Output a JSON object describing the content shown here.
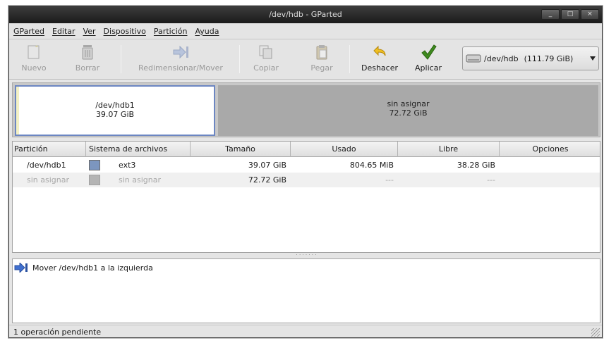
{
  "window": {
    "title": "/dev/hdb - GParted",
    "controls": {
      "minimize": "_",
      "maximize": "□",
      "close": "×"
    }
  },
  "menu": [
    "GParted",
    "Editar",
    "Ver",
    "Dispositivo",
    "Partición",
    "Ayuda"
  ],
  "toolbar": {
    "new": "Nuevo",
    "delete": "Borrar",
    "resize_move": "Redimensionar/Mover",
    "copy": "Copiar",
    "paste": "Pegar",
    "undo": "Deshacer",
    "apply": "Aplicar"
  },
  "device": {
    "name": "/dev/hdb",
    "size": "(111.79 GiB)"
  },
  "disk_map": [
    {
      "name": "/dev/hdb1",
      "size": "39.07 GiB"
    },
    {
      "name": "sin asignar",
      "size": "72.72 GiB"
    }
  ],
  "table": {
    "columns": [
      "Partición",
      "Sistema de archivos",
      "Tamaño",
      "Usado",
      "Libre",
      "Opciones"
    ],
    "rows": [
      {
        "partition": "/dev/hdb1",
        "filesystem": "ext3",
        "fs_color": "#7c96bf",
        "size": "39.07 GiB",
        "used": "804.65 MiB",
        "free": "38.28 GiB",
        "options": ""
      },
      {
        "partition": "sin asignar",
        "filesystem": "sin asignar",
        "fs_color": "#b4b4b4",
        "size": "72.72 GiB",
        "used": "---",
        "free": "---",
        "options": ""
      }
    ]
  },
  "operations": [
    "Mover /dev/hdb1 a la izquierda"
  ],
  "status": "1 operación pendiente",
  "colors": {
    "selection_border": "#6c86c2",
    "unallocated": "#a9a9a9",
    "apply_check": "#3e8a1e",
    "undo_arrow": "#d4a010",
    "move_arrow": "#3f6fcf"
  }
}
